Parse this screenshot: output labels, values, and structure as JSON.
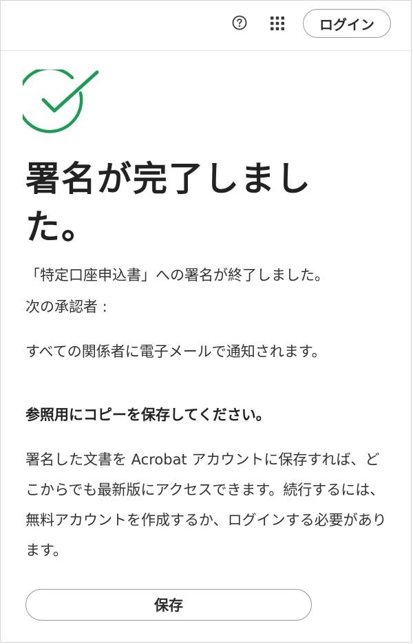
{
  "header": {
    "login_label": "ログイン",
    "help_icon": "help-circle-icon",
    "apps_icon": "app-grid-icon"
  },
  "status": {
    "icon": "checkmark-circle-icon",
    "color": "#1a9e54"
  },
  "main": {
    "title": "署名が完了しました。",
    "doc_status": "「特定口座申込書」への署名が終了しました。",
    "approver_label": "次の承認者 :",
    "notify_text": "すべての関係者に電子メールで通知されます。",
    "save_heading": "参照用にコピーを保存してください。",
    "account_text": "署名した文書を Acrobat アカウントに保存すれば、どこからでも最新版にアクセスできます。続行するには、無料アカウントを作成するか、ログインする必要があります。",
    "save_label": "保存"
  }
}
